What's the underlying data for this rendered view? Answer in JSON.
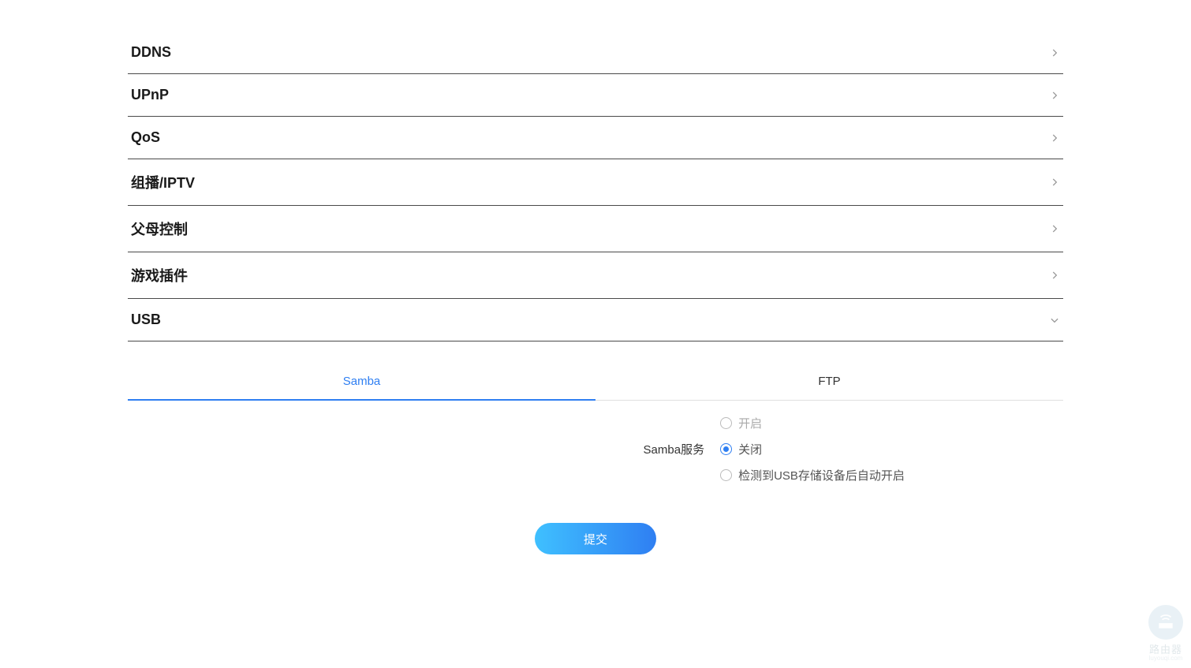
{
  "menu": {
    "items": [
      {
        "label": "DDNS",
        "expanded": false
      },
      {
        "label": "UPnP",
        "expanded": false
      },
      {
        "label": "QoS",
        "expanded": false
      },
      {
        "label": "组播/IPTV",
        "expanded": false
      },
      {
        "label": "父母控制",
        "expanded": false
      },
      {
        "label": "游戏插件",
        "expanded": false
      },
      {
        "label": "USB",
        "expanded": true
      }
    ]
  },
  "usb": {
    "tabs": [
      {
        "label": "Samba",
        "active": true
      },
      {
        "label": "FTP",
        "active": false
      }
    ],
    "samba": {
      "service_label": "Samba服务",
      "options": [
        {
          "label": "开启",
          "value": "on",
          "checked": false,
          "disabled": true
        },
        {
          "label": "关闭",
          "value": "off",
          "checked": true,
          "disabled": false
        },
        {
          "label": "检测到USB存储设备后自动开启",
          "value": "auto",
          "checked": false,
          "disabled": false
        }
      ]
    },
    "submit_label": "提交"
  },
  "watermark": {
    "text": "路由器",
    "sub": "luyouqi.com"
  }
}
